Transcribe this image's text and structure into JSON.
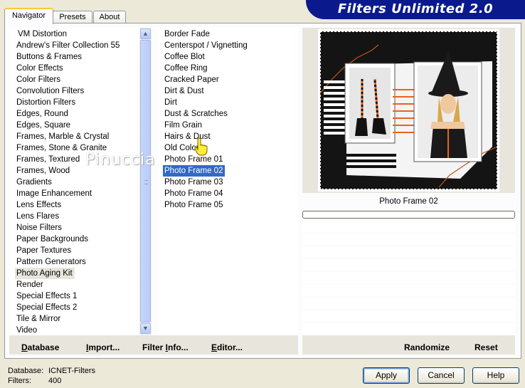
{
  "title": "Filters Unlimited 2.0",
  "tabs": [
    {
      "label": "Navigator",
      "active": true
    },
    {
      "label": "Presets",
      "active": false
    },
    {
      "label": "About",
      "active": false
    }
  ],
  "categories": [
    "VM Distortion",
    "Andrew's Filter Collection 55",
    "Buttons & Frames",
    "Color Effects",
    "Color Filters",
    "Convolution Filters",
    "Distortion Filters",
    "Edges, Round",
    "Edges, Square",
    "Frames, Marble & Crystal",
    "Frames, Stone & Granite",
    "Frames, Textured",
    "Frames, Wood",
    "Gradients",
    "Image Enhancement",
    "Lens Effects",
    "Lens Flares",
    "Noise Filters",
    "Paper Backgrounds",
    "Paper Textures",
    "Pattern Generators",
    "Photo Aging Kit",
    "Render",
    "Special Effects 1",
    "Special Effects 2",
    "Tile & Mirror",
    "Video"
  ],
  "selected_category": "Photo Aging Kit",
  "filters": [
    "Border Fade",
    "Centerspot / Vignetting",
    "Coffee Blot",
    "Coffee Ring",
    "Cracked Paper",
    "Dirt & Dust",
    "Dirt",
    "Dust & Scratches",
    "Film Grain",
    "Hairs & Dust",
    "Old Color",
    "Photo Frame 01",
    "Photo Frame 02",
    "Photo Frame 03",
    "Photo Frame 04",
    "Photo Frame 05"
  ],
  "selected_filter": "Photo Frame 02",
  "watermark": "Pinuccia",
  "preview_caption": "Photo Frame 02",
  "toolbar": {
    "database": {
      "hot": "D",
      "rest": "atabase"
    },
    "import": {
      "hot": "I",
      "rest": "mport..."
    },
    "filter_info": {
      "pre": "Filter ",
      "hot": "I",
      "rest": "nfo..."
    },
    "editor": {
      "hot": "E",
      "rest": "ditor..."
    },
    "randomize": "Randomize",
    "reset": "Reset"
  },
  "status": {
    "database_label": "Database:",
    "database_value": "ICNET-Filters",
    "filters_label": "Filters:",
    "filters_value": "400"
  },
  "buttons": {
    "apply": "Apply",
    "cancel": "Cancel",
    "help": "Help"
  },
  "icons": {
    "scroll_up": "chevron-up-icon",
    "scroll_down": "chevron-down-icon",
    "cursor": "hand-pointer-icon"
  },
  "colors": {
    "title_bg": "#0a1a8c",
    "selection": "#316ac5",
    "window_bg": "#ece9d8"
  }
}
